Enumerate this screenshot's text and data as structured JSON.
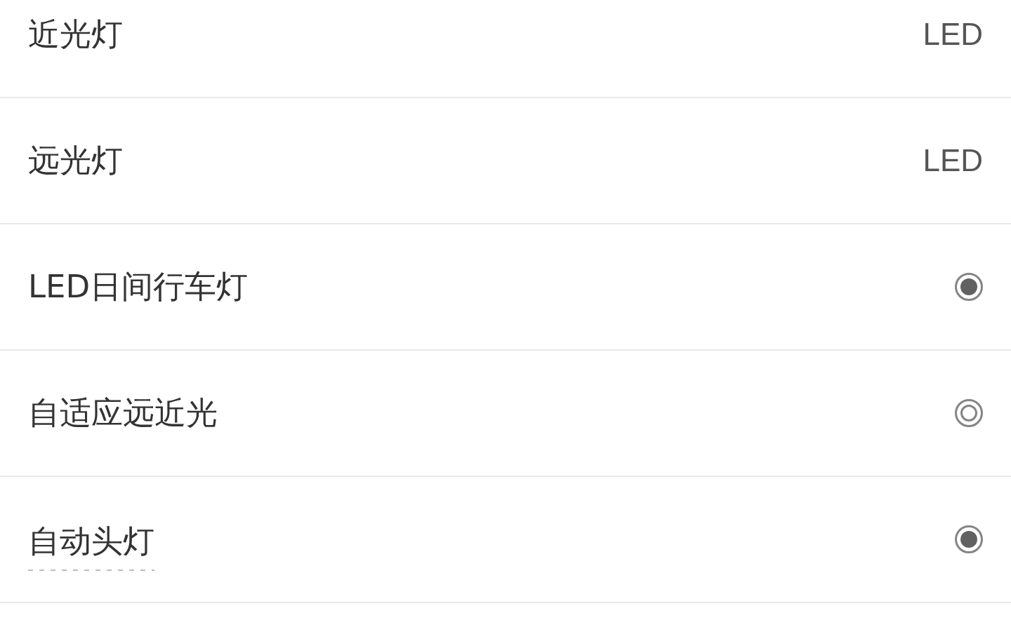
{
  "spec_rows": [
    {
      "kind": "value",
      "label": "近光灯",
      "value": "LED",
      "has_explanation": false
    },
    {
      "kind": "value",
      "label": "远光灯",
      "value": "LED",
      "has_explanation": false
    },
    {
      "kind": "indicator",
      "label": "LED日间行车灯",
      "standard": true,
      "has_explanation": false
    },
    {
      "kind": "indicator",
      "label": "自适应远近光",
      "standard": false,
      "has_explanation": false
    },
    {
      "kind": "indicator",
      "label": "自动头灯",
      "standard": true,
      "has_explanation": true
    }
  ]
}
